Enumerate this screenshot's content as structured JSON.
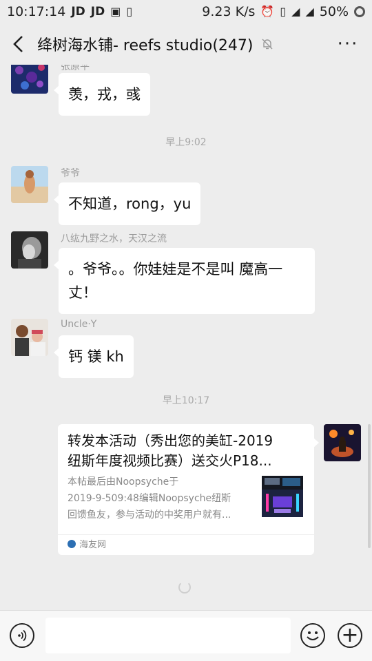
{
  "status_bar": {
    "time": "10:17:14",
    "notif_a": "JD",
    "notif_b": "JD",
    "net_speed": "9.23 K/s",
    "battery": "50%"
  },
  "header": {
    "title": "绛树海水铺- reefs studio(247)",
    "more_label": "···"
  },
  "messages": [
    {
      "sender": "张原平",
      "text": "羡，戎，彧"
    },
    {
      "time": "早上9:02"
    },
    {
      "sender": "爷爷",
      "text": "不知道，rong，yu"
    },
    {
      "sender": "八纮九野之水，天汉之流",
      "text_line1": "。爷爷。。你娃娃是不是叫 魔高一",
      "text_line2": "丈！"
    },
    {
      "sender": "Uncle·Y",
      "text": "钙 镁 kh"
    },
    {
      "time": "早上10:17"
    }
  ],
  "link_card": {
    "title_line1": "转发本活动（秀出您的美缸-2019",
    "title_line2": "纽斯年度视频比赛）送交火P18...",
    "desc_line1": "本帖最后由Noopsyche于",
    "desc_line2": "2019-9-509:48编辑Noopsyche纽斯",
    "desc_line3": "回馈鱼友，参与活动的中奖用户就有...",
    "source": "海友网"
  },
  "input_bar": {
    "plus_label": "+"
  },
  "colors": {
    "background": "#ededed",
    "bubble": "#ffffff",
    "meta_text": "#9a9a9a"
  }
}
